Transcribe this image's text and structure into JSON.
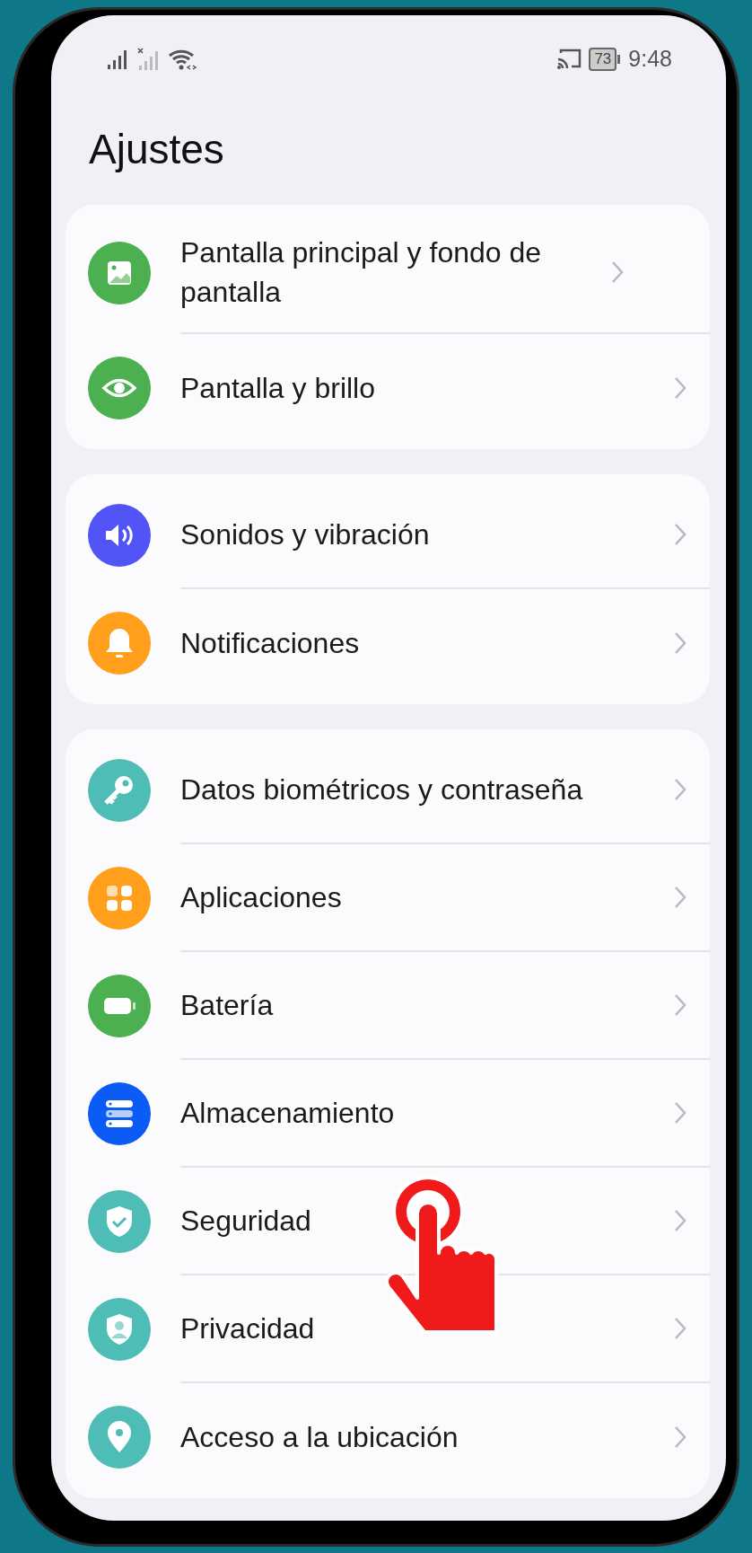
{
  "status_bar": {
    "battery": "73",
    "time": "9:48"
  },
  "title": "Ajustes",
  "groups": [
    {
      "items": [
        {
          "label": "Pantalla principal y fondo de pantalla",
          "kind": "image",
          "color": "#4caf50"
        },
        {
          "label": "Pantalla y brillo",
          "kind": "eye",
          "color": "#4caf50"
        }
      ]
    },
    {
      "items": [
        {
          "label": "Sonidos y vibración",
          "kind": "speaker",
          "color": "#5254f5"
        },
        {
          "label": "Notificaciones",
          "kind": "bell",
          "color": "#ff9f1c"
        }
      ]
    },
    {
      "items": [
        {
          "label": "Datos biométricos y contraseña",
          "kind": "key",
          "color": "#4dbdb6"
        },
        {
          "label": "Aplicaciones",
          "kind": "apps",
          "color": "#ff9f1c"
        },
        {
          "label": "Batería",
          "kind": "battery",
          "color": "#4caf50"
        },
        {
          "label": "Almacenamiento",
          "kind": "storage",
          "color": "#0a5cf5"
        },
        {
          "label": "Seguridad",
          "kind": "shield",
          "color": "#4dbdb6"
        },
        {
          "label": "Privacidad",
          "kind": "person-shield",
          "color": "#4dbdb6"
        },
        {
          "label": "Acceso a la ubicación",
          "kind": "pin",
          "color": "#4dbdb6"
        }
      ]
    }
  ]
}
